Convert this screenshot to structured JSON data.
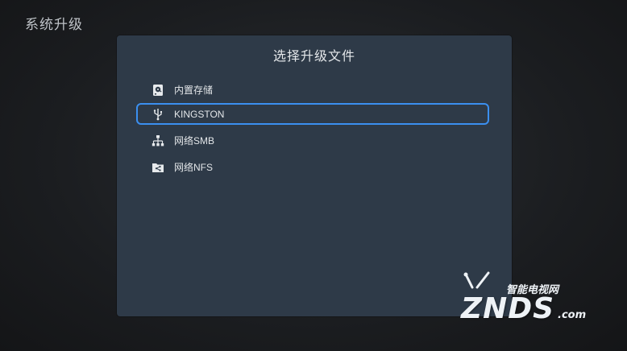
{
  "page": {
    "title": "系统升级"
  },
  "dialog": {
    "title": "选择升级文件",
    "items": [
      {
        "icon": "hard-drive-icon",
        "label": "内置存储",
        "selected": false
      },
      {
        "icon": "usb-icon",
        "label": "KINGSTON",
        "selected": true
      },
      {
        "icon": "network-icon",
        "label": "网络SMB",
        "selected": false
      },
      {
        "icon": "shared-folder-icon",
        "label": "网络NFS",
        "selected": false
      }
    ]
  },
  "watermark": {
    "top": "智能电视网",
    "main": "ZNDS",
    "suffix": ".com"
  },
  "colors": {
    "accent": "#3b8ff0",
    "dialog_bg": "#2e3a48",
    "text": "#e3e6e9"
  }
}
